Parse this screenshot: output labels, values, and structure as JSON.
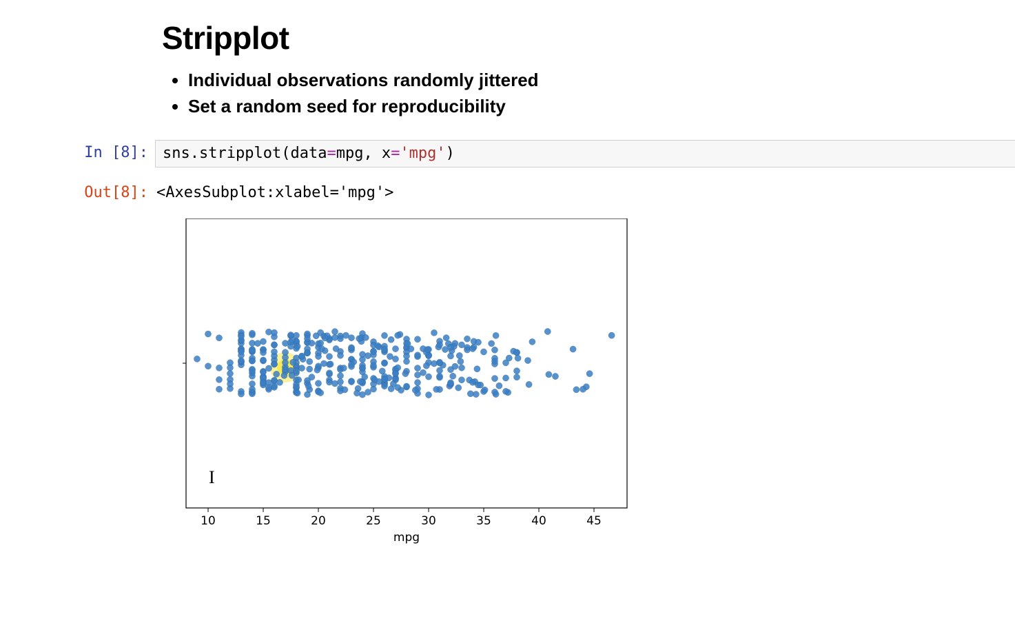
{
  "heading": "Stripplot",
  "bullets": [
    "Individual observations randomly jittered",
    "Set a random seed for reproducibility"
  ],
  "cell": {
    "in_prompt": "In [8]:",
    "out_prompt": "Out[8]:",
    "code_plain": "sns.stripplot(data=mpg, x='mpg')",
    "output_text": "<AxesSubplot:xlabel='mpg'>"
  },
  "chart_data": {
    "type": "scatter",
    "title": "",
    "xlabel": "mpg",
    "ylabel": "",
    "xlim": [
      8,
      48
    ],
    "x_ticks": [
      10,
      15,
      20,
      25,
      30,
      35,
      40,
      45
    ],
    "y_is_categorical_jitter": true,
    "jitter_range": [
      -0.4,
      0.4
    ],
    "point_color": "#3b7fc4",
    "point_alpha": 0.85,
    "highlight": {
      "x": 17,
      "color": "#f7e84a"
    },
    "series": [
      {
        "name": "mpg",
        "x": [
          18,
          15,
          18,
          16,
          17,
          15,
          14,
          14,
          14,
          15,
          15,
          14,
          15,
          14,
          24,
          22,
          18,
          21,
          27,
          26,
          25,
          24,
          25,
          26,
          21,
          10,
          10,
          11,
          9,
          27,
          28,
          25,
          25,
          19,
          16,
          17,
          19,
          18,
          14,
          14,
          14,
          14,
          12,
          13,
          13,
          18,
          22,
          19,
          18,
          23,
          28,
          30,
          30,
          31,
          35,
          27,
          26,
          24,
          25,
          23,
          20,
          21,
          13,
          14,
          15,
          14,
          17,
          11,
          13,
          12,
          13,
          19,
          15,
          13,
          13,
          14,
          18,
          22,
          21,
          26,
          22,
          28,
          23,
          28,
          27,
          13,
          14,
          13,
          14,
          15,
          12,
          13,
          13,
          14,
          13,
          12,
          13,
          18,
          16,
          18,
          18,
          23,
          26,
          11,
          12,
          13,
          12,
          18,
          20,
          21,
          22,
          18,
          19,
          21,
          26,
          15,
          16,
          29,
          24,
          20,
          19,
          15,
          24,
          20,
          11,
          20,
          21,
          19,
          15,
          31,
          26,
          32,
          25,
          16,
          16,
          18,
          16,
          13,
          14,
          14,
          14,
          29,
          26,
          26,
          31,
          32,
          28,
          24,
          26,
          24,
          26,
          31,
          19,
          18,
          15,
          15,
          16,
          15,
          16,
          14,
          17,
          16,
          15,
          18,
          21,
          20,
          13,
          29,
          23,
          20,
          23,
          24,
          25,
          24,
          18,
          29,
          19,
          23,
          23,
          22,
          25,
          33,
          28,
          25,
          25,
          26,
          27,
          17.5,
          16,
          15.5,
          14.5,
          22,
          22,
          24,
          22.5,
          29,
          24.5,
          29,
          33,
          20,
          18,
          18.5,
          17.5,
          29.5,
          32,
          28,
          26.5,
          20,
          13,
          19,
          19,
          31,
          30,
          36,
          25.5,
          33.5,
          17.5,
          17,
          15.5,
          15,
          17.5,
          20.5,
          19,
          18.5,
          16,
          15.5,
          15.5,
          16,
          29,
          24.5,
          26,
          25.5,
          30.5,
          33.5,
          30,
          30.5,
          22,
          21.5,
          21.5,
          43.1,
          36.1,
          32.8,
          39.4,
          36.1,
          19.9,
          19.4,
          20.2,
          19.2,
          25.1,
          20.5,
          19.4,
          20.6,
          20.8,
          18.6,
          18.1,
          19.2,
          17.7,
          18.1,
          17.5,
          30,
          27.5,
          27.2,
          30.9,
          21.1,
          23.2,
          23.8,
          23.9,
          20.3,
          17,
          21.6,
          16.2,
          31.5,
          29.5,
          21.5,
          19.8,
          22.3,
          20.2,
          20.6,
          17,
          17.6,
          16.5,
          18.2,
          16.9,
          15.5,
          19.2,
          18.5,
          31.9,
          34.1,
          35.7,
          27.4,
          25.4,
          23,
          27.2,
          23.9,
          34.2,
          34.5,
          31.8,
          37.3,
          28.4,
          28.8,
          26.8,
          33.5,
          41.5,
          38.1,
          32.1,
          37.2,
          28,
          26.4,
          24.3,
          19.1,
          34.3,
          29.8,
          31.3,
          37,
          32.2,
          46.6,
          27.9,
          40.8,
          44.3,
          43.4,
          36.4,
          30,
          44.6,
          40.9,
          33.8,
          29.8,
          32.7,
          23.7,
          35,
          23.6,
          32.4,
          27.2,
          26.6,
          25.8,
          23.5,
          30,
          39.1,
          39,
          35.1,
          32.3,
          37,
          37.7,
          34.1,
          34.7,
          34.4,
          29.9,
          33,
          34.5,
          33.7,
          32.4,
          32.9,
          31.6,
          28.1,
          30.7,
          24.2,
          22.4,
          26.6,
          20.2,
          17.6,
          28,
          27,
          34,
          31,
          29,
          27,
          24,
          23,
          36,
          37,
          31,
          38,
          36,
          36,
          36,
          34,
          38,
          32,
          38,
          25,
          38,
          26,
          22,
          32,
          36,
          27,
          27,
          44,
          32,
          28,
          31
        ]
      }
    ]
  }
}
